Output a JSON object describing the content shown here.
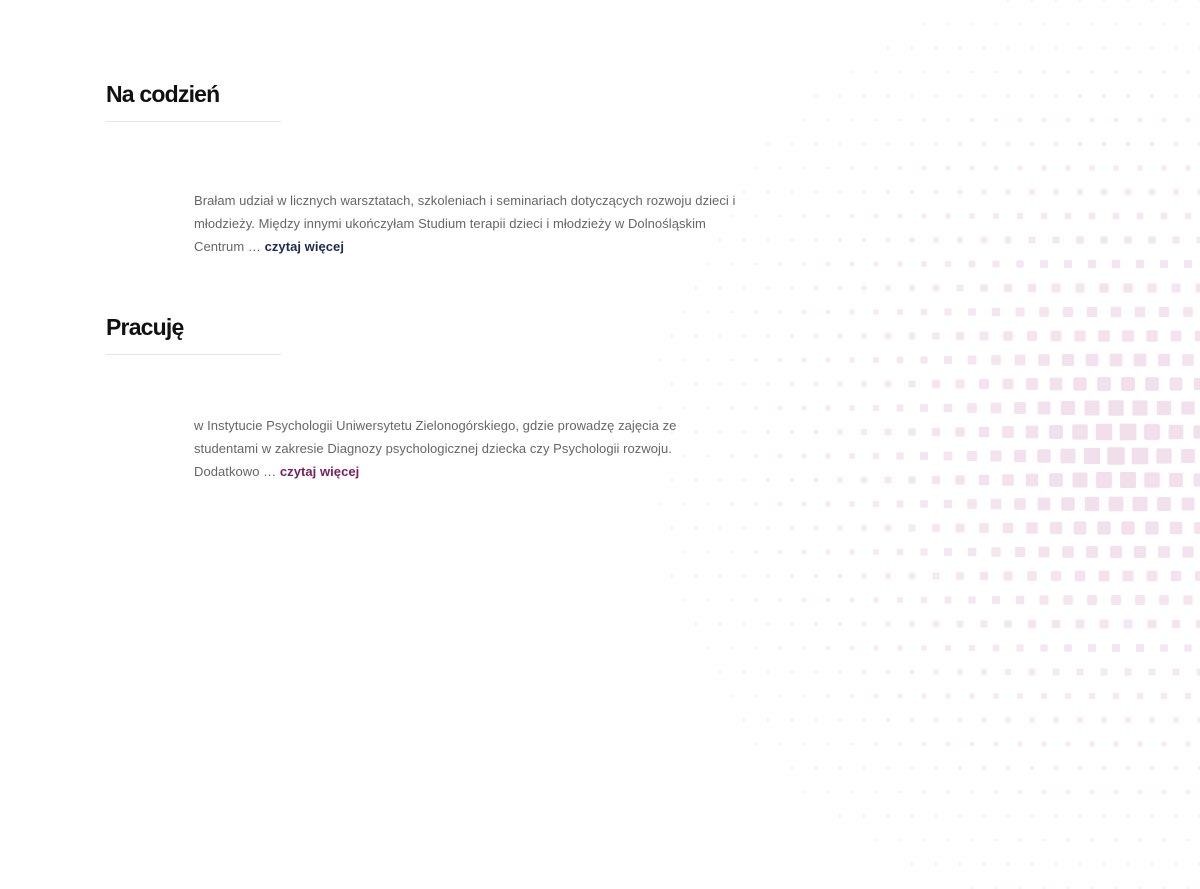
{
  "colors": {
    "pattern": "#f0dcea",
    "link_1": "#1f2a4d",
    "link_2": "#7a1f5c"
  },
  "sections": [
    {
      "heading": "Na codzień",
      "text": "Brałam udział w licznych warsztatach, szkoleniach i seminariach dotyczących rozwoju dzieci i młodzieży. Między innymi ukończyłam Studium terapii dzieci i młodzieży w Dolnośląskim Centrum … ",
      "more_label": "czytaj więcej"
    },
    {
      "heading": "Pracuję",
      "text": "w Instytucie Psychologii Uniwersytetu Zielonogórskiego, gdzie prowadzę zajęcia ze studentami w zakresie Diagnozy psychologicznej dziecka czy Psychologii rozwoju. Dodatkowo … ",
      "more_label": "czytaj więcej"
    }
  ]
}
